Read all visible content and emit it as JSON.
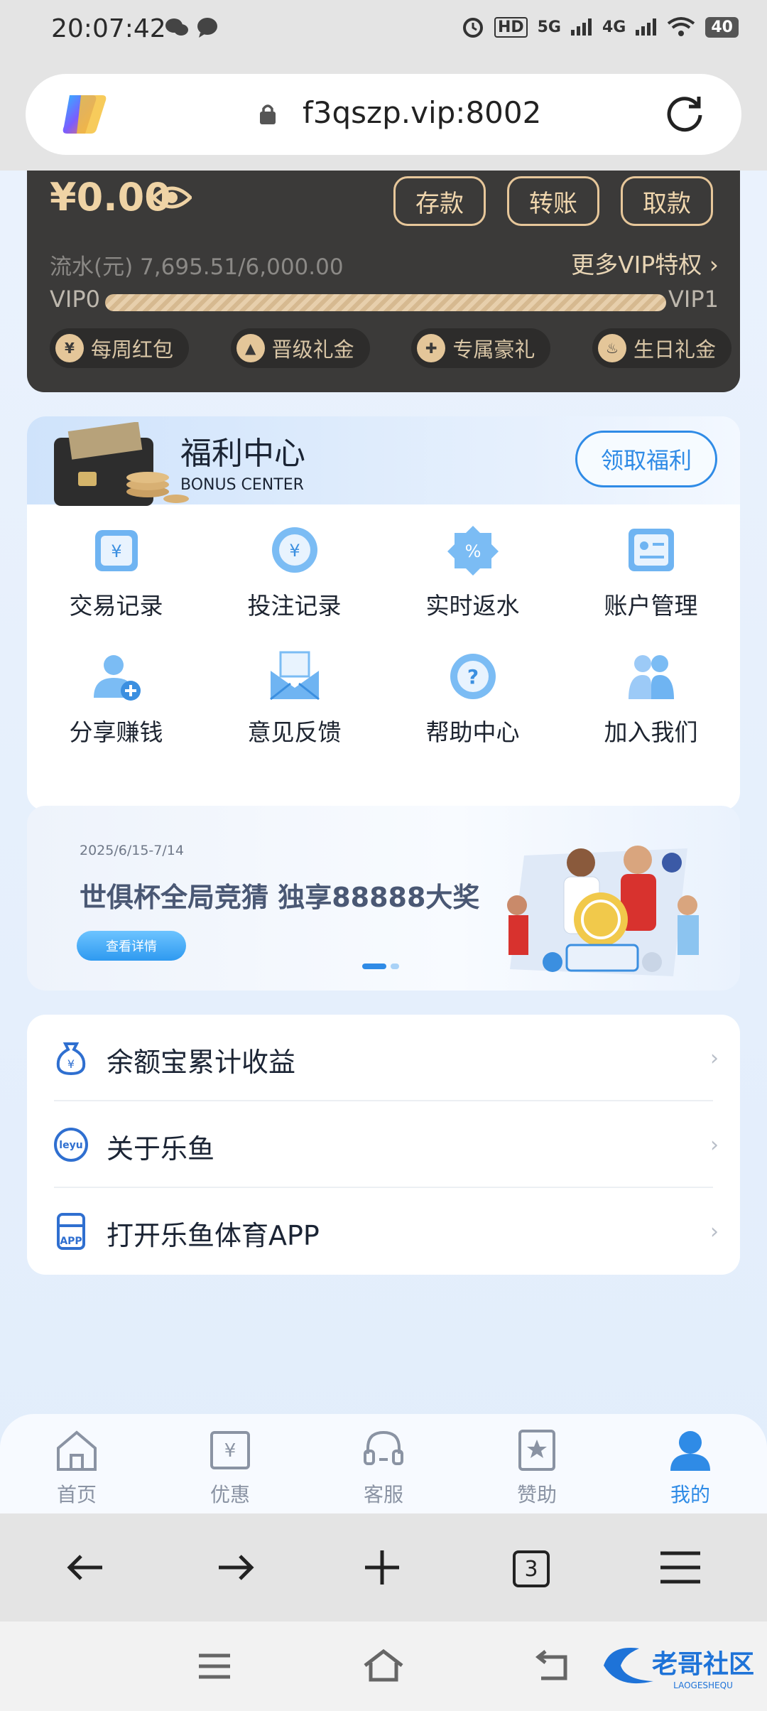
{
  "status_bar": {
    "time": "20:07:42",
    "network_labels": [
      "HD",
      "5G",
      "4G"
    ],
    "battery": "40"
  },
  "browser": {
    "url": "f3qszp.vip:8002",
    "tab_count": "3"
  },
  "vip_card": {
    "balance": "¥0.00",
    "buttons": [
      "存款",
      "转账",
      "取款"
    ],
    "turnover": "流水(元) 7,695.51/6,000.00",
    "more_vip": "更多VIP特权",
    "level_from": "VIP0",
    "level_to": "VIP1",
    "progress_fraction": 1.0,
    "perks": [
      "每周红包",
      "晋级礼金",
      "专属豪礼",
      "生日礼金"
    ]
  },
  "bonus_center": {
    "title": "福利中心",
    "subtitle": "BONUS CENTER",
    "claim_button": "领取福利",
    "items": [
      {
        "label": "交易记录",
        "icon": "trade-record-icon"
      },
      {
        "label": "投注记录",
        "icon": "bet-record-icon"
      },
      {
        "label": "实时返水",
        "icon": "rebate-icon"
      },
      {
        "label": "账户管理",
        "icon": "account-icon"
      },
      {
        "label": "分享赚钱",
        "icon": "share-icon"
      },
      {
        "label": "意见反馈",
        "icon": "feedback-icon"
      },
      {
        "label": "帮助中心",
        "icon": "help-icon"
      },
      {
        "label": "加入我们",
        "icon": "join-icon"
      }
    ]
  },
  "banner": {
    "date": "2025/6/15-7/14",
    "title": "世俱杯全局竞猜 独享88888大奖",
    "button": "查看详情"
  },
  "menu_list": [
    {
      "label": "余额宝累计收益",
      "icon": "money-bag-icon"
    },
    {
      "label": "关于乐鱼",
      "icon": "leyu-logo-icon"
    },
    {
      "label": "打开乐鱼体育APP",
      "icon": "app-icon"
    }
  ],
  "tab_bar": [
    {
      "label": "首页",
      "icon": "home-icon"
    },
    {
      "label": "优惠",
      "icon": "coupon-icon"
    },
    {
      "label": "客服",
      "icon": "headset-icon"
    },
    {
      "label": "赞助",
      "icon": "sponsor-icon"
    },
    {
      "label": "我的",
      "icon": "user-icon"
    }
  ],
  "colors": {
    "accent": "#2f8be6",
    "vip_gold": "#e7c79a",
    "vip_card_bg": "#3b3a39"
  }
}
